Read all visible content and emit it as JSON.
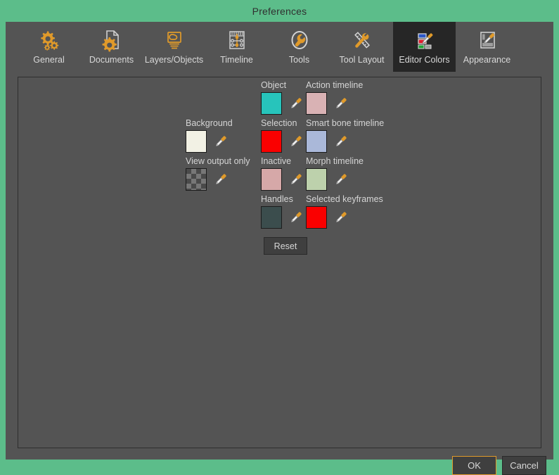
{
  "window": {
    "title": "Preferences",
    "frame_color": "#5cbd8a",
    "body_color": "#545454"
  },
  "tabs": [
    {
      "label": "General",
      "icon": "gears-icon",
      "selected": false
    },
    {
      "label": "Documents",
      "icon": "document-gear-icon",
      "selected": false
    },
    {
      "label": "Layers/Objects",
      "icon": "layers-objects-icon",
      "selected": false
    },
    {
      "label": "Timeline",
      "icon": "timeline-icon",
      "selected": false
    },
    {
      "label": "Tools",
      "icon": "wrench-icon",
      "selected": false
    },
    {
      "label": "Tool Layout",
      "icon": "tool-layout-icon",
      "selected": false
    },
    {
      "label": "Editor Colors",
      "icon": "editor-colors-icon",
      "selected": true
    },
    {
      "label": "Appearance",
      "icon": "appearance-icon",
      "selected": false
    }
  ],
  "editor_colors": {
    "columns": [
      {
        "name": "column-1",
        "entries": [
          {
            "label": "Background",
            "color": "#f2f1e4",
            "swatch_type": "solid",
            "picker_icon": "eyedropper-icon"
          },
          {
            "label": "View output only",
            "color": "#4a4a4a",
            "swatch_type": "checker",
            "picker_icon": "eyedropper-icon"
          }
        ]
      },
      {
        "name": "column-2",
        "entries": [
          {
            "label": "Object",
            "color": "#27c4bb",
            "swatch_type": "solid",
            "picker_icon": "eyedropper-icon"
          },
          {
            "label": "Selection",
            "color": "#fa0000",
            "swatch_type": "solid",
            "picker_icon": "eyedropper-icon"
          },
          {
            "label": "Inactive",
            "color": "#d6a8a8",
            "swatch_type": "solid",
            "picker_icon": "eyedropper-icon"
          },
          {
            "label": "Handles",
            "color": "#3b4d4d",
            "swatch_type": "solid",
            "picker_icon": "eyedropper-icon"
          }
        ]
      },
      {
        "name": "column-3",
        "entries": [
          {
            "label": "Action timeline",
            "color": "#d9b2b4",
            "swatch_type": "solid",
            "picker_icon": "eyedropper-icon"
          },
          {
            "label": "Smart bone timeline",
            "color": "#aab8d9",
            "swatch_type": "solid",
            "picker_icon": "eyedropper-icon"
          },
          {
            "label": "Morph timeline",
            "color": "#bdd1ac",
            "swatch_type": "solid",
            "picker_icon": "eyedropper-icon"
          },
          {
            "label": "Selected keyframes",
            "color": "#fa0000",
            "swatch_type": "solid",
            "picker_icon": "eyedropper-icon"
          }
        ]
      }
    ],
    "reset_label": "Reset"
  },
  "footer": {
    "ok_label": "OK",
    "cancel_label": "Cancel",
    "focus_border_color": "#e09a2a"
  }
}
